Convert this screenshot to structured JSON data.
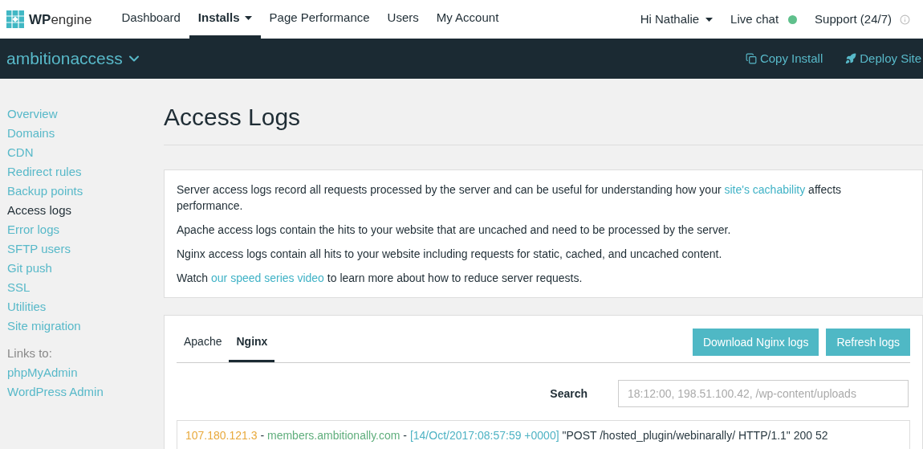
{
  "brand": {
    "strong": "WP",
    "light": "engine"
  },
  "nav": [
    {
      "label": "Dashboard",
      "selected": false,
      "dropdown": false
    },
    {
      "label": "Installs",
      "selected": true,
      "dropdown": true
    },
    {
      "label": "Page Performance",
      "selected": false,
      "dropdown": false
    },
    {
      "label": "Users",
      "selected": false,
      "dropdown": false
    },
    {
      "label": "My Account",
      "selected": false,
      "dropdown": false
    }
  ],
  "user_menu": {
    "label": "Hi Nathalie"
  },
  "live_chat": {
    "label": "Live chat",
    "online": true
  },
  "support": {
    "label": "Support (24/7)"
  },
  "install_bar": {
    "name": "ambitionaccess",
    "actions": [
      {
        "kind": "copy",
        "label": "Copy Install"
      },
      {
        "kind": "deploy",
        "label": "Deploy Site"
      }
    ]
  },
  "sidebar": {
    "items": [
      {
        "label": "Overview",
        "selected": false
      },
      {
        "label": "Domains",
        "selected": false
      },
      {
        "label": "CDN",
        "selected": false
      },
      {
        "label": "Redirect rules",
        "selected": false
      },
      {
        "label": "Backup points",
        "selected": false
      },
      {
        "label": "Access logs",
        "selected": true
      },
      {
        "label": "Error logs",
        "selected": false
      },
      {
        "label": "SFTP users",
        "selected": false
      },
      {
        "label": "Git push",
        "selected": false
      },
      {
        "label": "SSL",
        "selected": false
      },
      {
        "label": "Utilities",
        "selected": false
      },
      {
        "label": "Site migration",
        "selected": false
      }
    ],
    "links_heading": "Links to:",
    "links": [
      "phpMyAdmin",
      "WordPress Admin"
    ]
  },
  "page_title": "Access Logs",
  "info_paragraphs": [
    [
      {
        "kind": "text",
        "text": "Server access logs record all requests processed by the server and can be useful for understanding how your "
      },
      {
        "kind": "link",
        "text": "site's cachability"
      },
      {
        "kind": "text",
        "text": " affects performance."
      }
    ],
    [
      {
        "kind": "text",
        "text": "Apache access logs contain the hits to your website that are uncached and need to be processed by the server."
      }
    ],
    [
      {
        "kind": "text",
        "text": "Nginx access logs contain all hits to your website including requests for static, cached, and uncached content."
      }
    ],
    [
      {
        "kind": "text",
        "text": "Watch "
      },
      {
        "kind": "link",
        "text": "our speed series video"
      },
      {
        "kind": "text",
        "text": " to learn more about how to reduce server requests."
      }
    ]
  ],
  "log_tabs": [
    {
      "label": "Apache",
      "selected": false
    },
    {
      "label": "Nginx",
      "selected": true
    }
  ],
  "log_buttons": [
    "Download Nginx logs",
    "Refresh logs"
  ],
  "search": {
    "label": "Search",
    "placeholder": "18:12:00, 198.51.100.42, /wp-content/uploads"
  },
  "log_lines": [
    [
      {
        "kind": "ip",
        "text": "107.180.121.3"
      },
      {
        "kind": "plain",
        "text": " - "
      },
      {
        "kind": "host",
        "text": "members.ambitionally.com"
      },
      {
        "kind": "plain",
        "text": " - "
      },
      {
        "kind": "date",
        "text": "[14/Oct/2017:08:57:59 +0000]"
      },
      {
        "kind": "plain",
        "text": " \"POST /hosted_plugin/webinarally/ HTTP/1.1\" 200 52"
      }
    ]
  ]
}
